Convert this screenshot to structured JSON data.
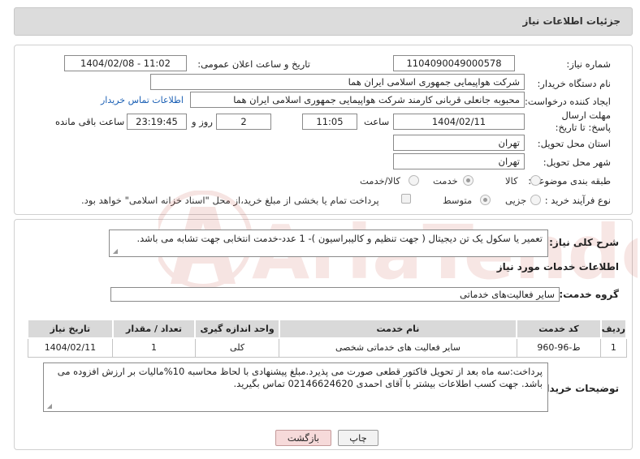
{
  "page": {
    "title": "جزئیات اطلاعات نیاز"
  },
  "info": {
    "need_number_label": "شماره نیاز:",
    "need_number": "1104090049000578",
    "announce_label": "تاریخ و ساعت اعلان عمومی:",
    "announce_value": "1404/02/08 - 11:02",
    "buyer_org_label": "نام دستگاه خریدار:",
    "buyer_org": "شرکت هواپیمایی جمهوری اسلامی ایران هما",
    "requester_label": "ایجاد کننده درخواست:",
    "requester": "محبوبه جانعلی قربانی کارمند شرکت هواپیمایی جمهوری اسلامی ایران هما",
    "contact_link": "اطلاعات تماس خریدار",
    "deadline_label": "مهلت ارسال پاسخ: تا تاریخ:",
    "deadline_date": "1404/02/11",
    "time_label": "ساعت",
    "deadline_time": "11:05",
    "days_value": "2",
    "days_label": "روز و",
    "remaining_time": "23:19:45",
    "remaining_label": "ساعت باقی مانده",
    "province_label": "استان محل تحویل:",
    "province": "تهران",
    "city_label": "شهر محل تحویل:",
    "city": "تهران",
    "category_label": "طبقه بندی موضوعی:",
    "category_options": [
      "کالا",
      "خدمت",
      "کالا/خدمت"
    ],
    "process_label": "نوع فرآیند خرید :",
    "process_options": [
      "جزیی",
      "متوسط"
    ],
    "payment_note": "پرداخت تمام یا بخشی از مبلغ خرید،از محل \"اسناد خزانه اسلامی\" خواهد بود."
  },
  "details": {
    "summary_label": "شرح کلی نیاز:",
    "summary": "تعمیر یا سکول یک تن دیجیتال ( جهت تنظیم و کالیبراسیون )- 1 عدد-خدمت انتخابی جهت تشابه می باشد.",
    "services_heading": "اطلاعات خدمات مورد نیاز",
    "service_group_label": "گروه خدمت:",
    "service_group": "سایر فعالیت‌های خدماتی",
    "table": {
      "headers": [
        "ردیف",
        "کد خدمت",
        "نام خدمت",
        "واحد اندازه گیری",
        "تعداد / مقدار",
        "تاریخ نیاز"
      ],
      "rows": [
        [
          "1",
          "ط-96-960",
          "سایر فعالیت های خدماتی شخصی",
          "کلی",
          "1",
          "1404/02/11"
        ]
      ]
    },
    "notes_label": "توضیحات خریدار:",
    "notes": "پرداخت:سه ماه بعد از تحویل فاکتور قطعی صورت می پذیرد.مبلغ پیشنهادی با لحاظ محاسبه 10%مالیات بر ارزش افزوده می باشد. جهت کسب اطلاعات بیشتر با آقای احمدی 02146624620 تماس بگیرید."
  },
  "buttons": {
    "print": "چاپ",
    "back": "بازگشت"
  },
  "watermark": {
    "text": "AriaTender.neT"
  }
}
